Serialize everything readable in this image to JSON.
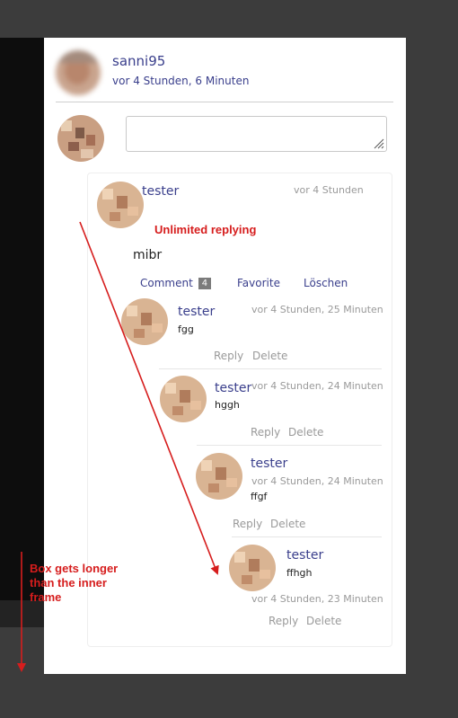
{
  "post": {
    "author": "sanni95",
    "time": "vor 4 Stunden, 6 Minuten"
  },
  "reply_box": {
    "value": "",
    "placeholder": ""
  },
  "comment": {
    "author": "tester",
    "time": "vor 4 Stunden",
    "text": "mibr",
    "comment_label": "Comment",
    "comment_count": "4",
    "favorite_label": "Favorite",
    "delete_label": "Löschen"
  },
  "replies": [
    {
      "author": "tester",
      "time": "vor 4 Stunden, 25 Minuten",
      "text": "fgg",
      "reply_label": "Reply",
      "delete_label": "Delete"
    },
    {
      "author": "tester",
      "time": "vor 4 Stunden, 24 Minuten",
      "text": "hggh",
      "reply_label": "Reply",
      "delete_label": "Delete"
    },
    {
      "author": "tester",
      "time": "vor 4 Stunden, 24 Minuten",
      "text": "ffgf",
      "reply_label": "Reply",
      "delete_label": "Delete"
    },
    {
      "author": "tester",
      "time": "vor 4 Stunden, 23 Minuten",
      "text": "ffhgh",
      "reply_label": "Reply",
      "delete_label": "Delete"
    }
  ],
  "annotations": {
    "unlimited": "Unlimited replying",
    "box_longer_line1": "Box gets longer",
    "box_longer_line2": "than the inner",
    "box_longer_line3": "frame"
  },
  "colors": {
    "annotation_red": "#d61d1d",
    "username_navy": "#3a3f8c",
    "meta_gray": "#9a9a9a",
    "badge_gray": "#7b7b7b"
  }
}
